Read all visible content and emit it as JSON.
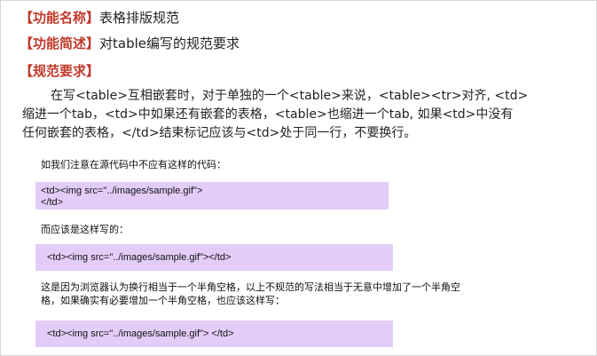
{
  "func_name": {
    "label": "【功能名称】",
    "value": "表格排版规范"
  },
  "func_desc": {
    "label": "【功能简述】",
    "value": "对table编写的规范要求"
  },
  "requirements": {
    "label": "【规范要求】",
    "lines": [
      "在写<table>互相嵌套时，对于单独的一个<table>来说，<table><tr>对齐, <td>",
      "缩进一个tab，<td>中如果还有嵌套的表格，<table>也缩进一个tab, 如果<td>中没有",
      "任何嵌套的表格，</td>结束标记应该与<td>处于同一行，不要换行。"
    ]
  },
  "example": {
    "intro": "如我们注意在源代码中不应有这样的代码：",
    "bad_code_line1": "<td><img src=\"../images/sample.gif\">",
    "bad_code_line2": "</td>",
    "good_intro": "而应该是这样写的：",
    "good_code": "<td><img src=\"../images/sample.gif\"></td>",
    "reason_line1": "这是因为浏览器认为换行相当于一个半角空格，以上不规范的写法相当于无意中增加了一个半角空",
    "reason_line2": "格，如果确实有必要增加一个半角空格，也应该这样写：",
    "space_code": "<td><img src=\"../images/sample.gif\"> </td>"
  },
  "colors": {
    "label": "#c0392b",
    "code_bg": "#e3cdf8",
    "text": "#222222"
  }
}
